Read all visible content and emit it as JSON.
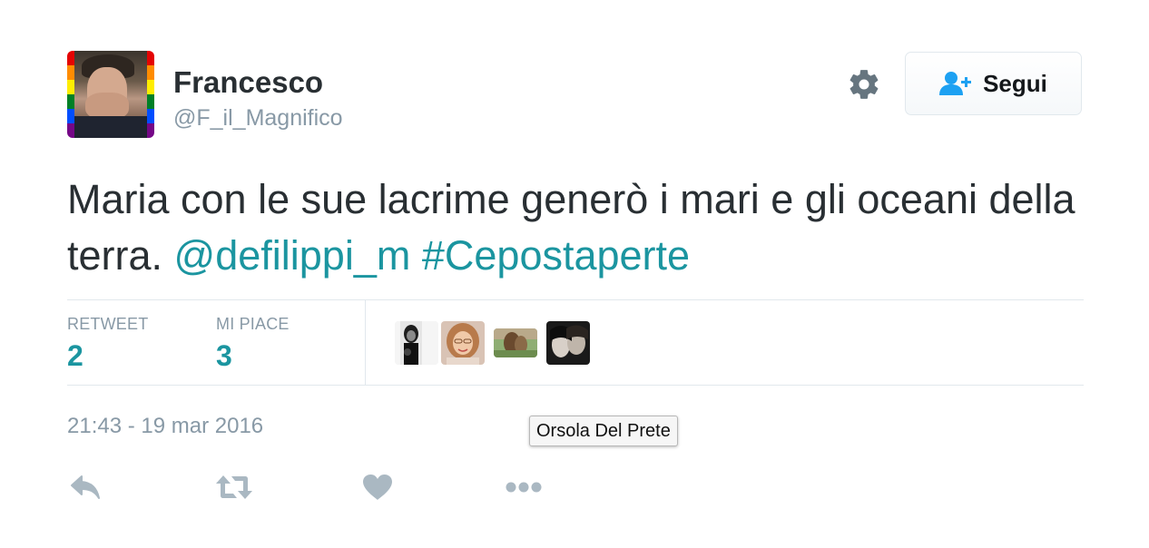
{
  "user": {
    "display_name": "Francesco",
    "handle": "@F_il_Magnifico",
    "avatar_icon": "rainbow-frame-avatar"
  },
  "header": {
    "settings_icon": "gear-icon",
    "follow_button": {
      "label": "Segui",
      "icon": "add-user-icon"
    }
  },
  "tweet": {
    "text_plain": "Maria con le sue lacrime generò i mari e gli oceani della terra.",
    "mention": "@defilippi_m",
    "hashtag": "#Cepostaperte"
  },
  "stats": {
    "retweet_label": "RETWEET",
    "retweet_count": "2",
    "like_label": "MI PIACE",
    "like_count": "3"
  },
  "likers": [
    {
      "icon": "liker-avatar-1"
    },
    {
      "icon": "liker-avatar-2"
    },
    {
      "icon": "liker-avatar-3"
    },
    {
      "icon": "liker-avatar-4"
    }
  ],
  "timestamp": "21:43 - 19 mar 2016",
  "tooltip": "Orsola Del Prete",
  "actions": [
    {
      "icon": "reply-icon"
    },
    {
      "icon": "retweet-icon"
    },
    {
      "icon": "heart-icon"
    },
    {
      "icon": "more-icon"
    }
  ],
  "colors": {
    "accent": "#1b95a0",
    "muted": "#8899a6",
    "text": "#292f33",
    "border": "#e1e8ed",
    "icon": "#aab8c2"
  }
}
